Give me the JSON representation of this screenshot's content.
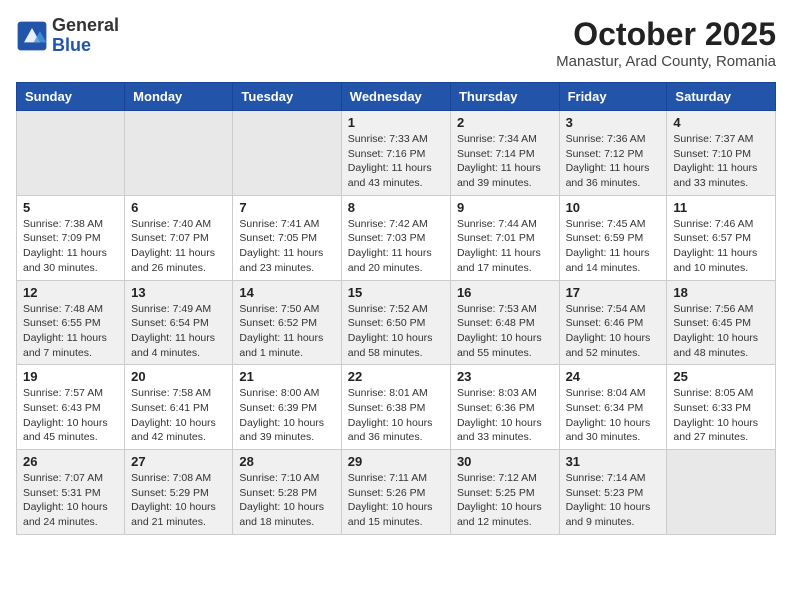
{
  "logo": {
    "general": "General",
    "blue": "Blue"
  },
  "title": "October 2025",
  "location": "Manastur, Arad County, Romania",
  "weekdays": [
    "Sunday",
    "Monday",
    "Tuesday",
    "Wednesday",
    "Thursday",
    "Friday",
    "Saturday"
  ],
  "weeks": [
    [
      {
        "day": "",
        "info": ""
      },
      {
        "day": "",
        "info": ""
      },
      {
        "day": "",
        "info": ""
      },
      {
        "day": "1",
        "info": "Sunrise: 7:33 AM\nSunset: 7:16 PM\nDaylight: 11 hours\nand 43 minutes."
      },
      {
        "day": "2",
        "info": "Sunrise: 7:34 AM\nSunset: 7:14 PM\nDaylight: 11 hours\nand 39 minutes."
      },
      {
        "day": "3",
        "info": "Sunrise: 7:36 AM\nSunset: 7:12 PM\nDaylight: 11 hours\nand 36 minutes."
      },
      {
        "day": "4",
        "info": "Sunrise: 7:37 AM\nSunset: 7:10 PM\nDaylight: 11 hours\nand 33 minutes."
      }
    ],
    [
      {
        "day": "5",
        "info": "Sunrise: 7:38 AM\nSunset: 7:09 PM\nDaylight: 11 hours\nand 30 minutes."
      },
      {
        "day": "6",
        "info": "Sunrise: 7:40 AM\nSunset: 7:07 PM\nDaylight: 11 hours\nand 26 minutes."
      },
      {
        "day": "7",
        "info": "Sunrise: 7:41 AM\nSunset: 7:05 PM\nDaylight: 11 hours\nand 23 minutes."
      },
      {
        "day": "8",
        "info": "Sunrise: 7:42 AM\nSunset: 7:03 PM\nDaylight: 11 hours\nand 20 minutes."
      },
      {
        "day": "9",
        "info": "Sunrise: 7:44 AM\nSunset: 7:01 PM\nDaylight: 11 hours\nand 17 minutes."
      },
      {
        "day": "10",
        "info": "Sunrise: 7:45 AM\nSunset: 6:59 PM\nDaylight: 11 hours\nand 14 minutes."
      },
      {
        "day": "11",
        "info": "Sunrise: 7:46 AM\nSunset: 6:57 PM\nDaylight: 11 hours\nand 10 minutes."
      }
    ],
    [
      {
        "day": "12",
        "info": "Sunrise: 7:48 AM\nSunset: 6:55 PM\nDaylight: 11 hours\nand 7 minutes."
      },
      {
        "day": "13",
        "info": "Sunrise: 7:49 AM\nSunset: 6:54 PM\nDaylight: 11 hours\nand 4 minutes."
      },
      {
        "day": "14",
        "info": "Sunrise: 7:50 AM\nSunset: 6:52 PM\nDaylight: 11 hours\nand 1 minute."
      },
      {
        "day": "15",
        "info": "Sunrise: 7:52 AM\nSunset: 6:50 PM\nDaylight: 10 hours\nand 58 minutes."
      },
      {
        "day": "16",
        "info": "Sunrise: 7:53 AM\nSunset: 6:48 PM\nDaylight: 10 hours\nand 55 minutes."
      },
      {
        "day": "17",
        "info": "Sunrise: 7:54 AM\nSunset: 6:46 PM\nDaylight: 10 hours\nand 52 minutes."
      },
      {
        "day": "18",
        "info": "Sunrise: 7:56 AM\nSunset: 6:45 PM\nDaylight: 10 hours\nand 48 minutes."
      }
    ],
    [
      {
        "day": "19",
        "info": "Sunrise: 7:57 AM\nSunset: 6:43 PM\nDaylight: 10 hours\nand 45 minutes."
      },
      {
        "day": "20",
        "info": "Sunrise: 7:58 AM\nSunset: 6:41 PM\nDaylight: 10 hours\nand 42 minutes."
      },
      {
        "day": "21",
        "info": "Sunrise: 8:00 AM\nSunset: 6:39 PM\nDaylight: 10 hours\nand 39 minutes."
      },
      {
        "day": "22",
        "info": "Sunrise: 8:01 AM\nSunset: 6:38 PM\nDaylight: 10 hours\nand 36 minutes."
      },
      {
        "day": "23",
        "info": "Sunrise: 8:03 AM\nSunset: 6:36 PM\nDaylight: 10 hours\nand 33 minutes."
      },
      {
        "day": "24",
        "info": "Sunrise: 8:04 AM\nSunset: 6:34 PM\nDaylight: 10 hours\nand 30 minutes."
      },
      {
        "day": "25",
        "info": "Sunrise: 8:05 AM\nSunset: 6:33 PM\nDaylight: 10 hours\nand 27 minutes."
      }
    ],
    [
      {
        "day": "26",
        "info": "Sunrise: 7:07 AM\nSunset: 5:31 PM\nDaylight: 10 hours\nand 24 minutes."
      },
      {
        "day": "27",
        "info": "Sunrise: 7:08 AM\nSunset: 5:29 PM\nDaylight: 10 hours\nand 21 minutes."
      },
      {
        "day": "28",
        "info": "Sunrise: 7:10 AM\nSunset: 5:28 PM\nDaylight: 10 hours\nand 18 minutes."
      },
      {
        "day": "29",
        "info": "Sunrise: 7:11 AM\nSunset: 5:26 PM\nDaylight: 10 hours\nand 15 minutes."
      },
      {
        "day": "30",
        "info": "Sunrise: 7:12 AM\nSunset: 5:25 PM\nDaylight: 10 hours\nand 12 minutes."
      },
      {
        "day": "31",
        "info": "Sunrise: 7:14 AM\nSunset: 5:23 PM\nDaylight: 10 hours\nand 9 minutes."
      },
      {
        "day": "",
        "info": ""
      }
    ]
  ]
}
